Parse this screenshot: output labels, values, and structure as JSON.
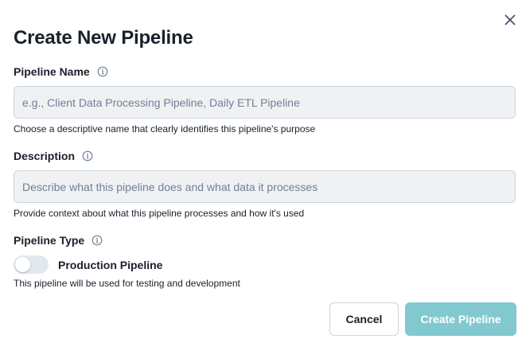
{
  "dialog": {
    "title": "Create New Pipeline",
    "close_icon": "close-icon"
  },
  "fields": {
    "name": {
      "label": "Pipeline Name",
      "placeholder": "e.g., Client Data Processing Pipeline, Daily ETL Pipeline",
      "value": "",
      "help": "Choose a descriptive name that clearly identifies this pipeline's purpose",
      "info_icon": "info-icon"
    },
    "description": {
      "label": "Description",
      "placeholder": "Describe what this pipeline does and what data it processes",
      "value": "",
      "help": "Provide context about what this pipeline processes and how it's used",
      "info_icon": "info-icon"
    },
    "type": {
      "label": "Pipeline Type",
      "toggle_label": "Production Pipeline",
      "toggle_on": false,
      "help": "This pipeline will be used for testing and development",
      "info_icon": "info-icon"
    }
  },
  "actions": {
    "cancel_label": "Cancel",
    "create_label": "Create Pipeline"
  },
  "colors": {
    "primary_disabled": "#81c9cf",
    "text": "#1a202c",
    "input_bg": "#f0f1f3",
    "border": "#cbd5e0"
  }
}
